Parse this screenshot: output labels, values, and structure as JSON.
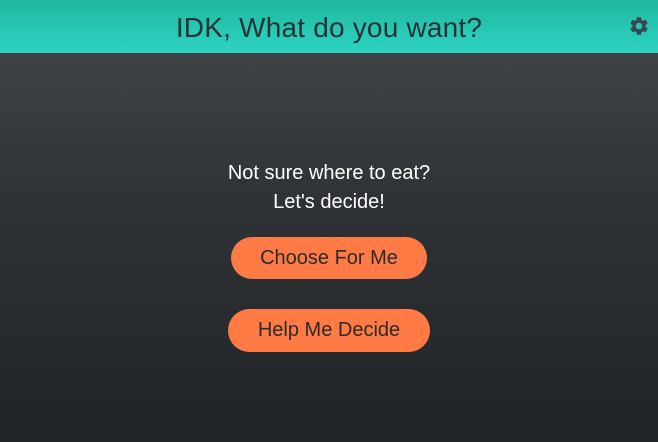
{
  "header": {
    "title": "IDK, What do you want?",
    "settings_icon": "gear-icon"
  },
  "main": {
    "prompt_line1": "Not sure where to eat?",
    "prompt_line2": "Let's decide!",
    "choose_button_label": "Choose For Me",
    "help_button_label": "Help Me Decide"
  },
  "colors": {
    "header_bg": "#2ed4c2",
    "accent_button": "#ff7a45",
    "background_dark": "#2f3337"
  }
}
